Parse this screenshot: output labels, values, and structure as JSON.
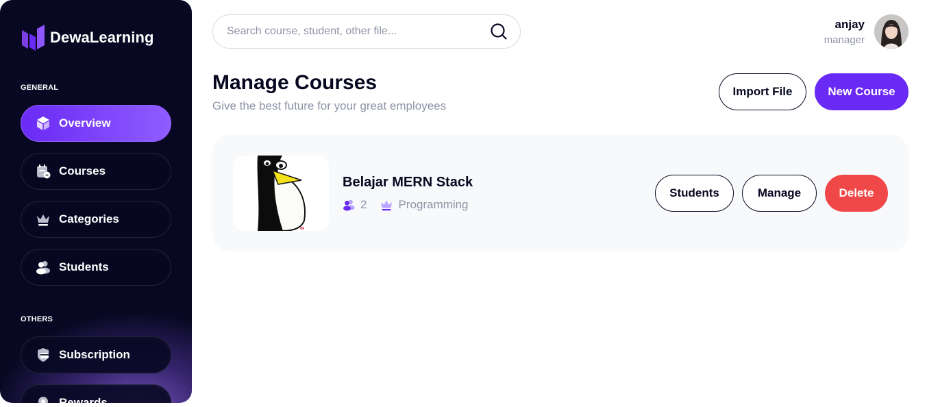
{
  "brand": {
    "name": "DewaLearning"
  },
  "sidebar": {
    "general_label": "GENERAL",
    "others_label": "OTHERS",
    "items": [
      {
        "label": "Overview",
        "icon": "cube-icon",
        "active": true
      },
      {
        "label": "Courses",
        "icon": "calendar-note-icon",
        "active": false
      },
      {
        "label": "Categories",
        "icon": "crown-icon",
        "active": false
      },
      {
        "label": "Students",
        "icon": "users-icon",
        "active": false
      }
    ],
    "other_items": [
      {
        "label": "Subscription",
        "icon": "card-shield-icon"
      },
      {
        "label": "Rewards",
        "icon": "medal-icon"
      }
    ]
  },
  "search": {
    "placeholder": "Search course, student, other file...",
    "value": ""
  },
  "user": {
    "name": "anjay",
    "role": "manager"
  },
  "header": {
    "title": "Manage Courses",
    "subtitle": "Give the best future for your great employees",
    "import_label": "Import File",
    "new_label": "New Course"
  },
  "course": {
    "title": "Belajar MERN Stack",
    "students": "2",
    "category": "Programming",
    "students_label": "Students",
    "manage_label": "Manage",
    "delete_label": "Delete"
  },
  "colors": {
    "accent": "#6a2af5",
    "danger": "#f04848",
    "dark": "#070720",
    "muted": "#8e93a6",
    "sidebar_bg": "#080822"
  }
}
